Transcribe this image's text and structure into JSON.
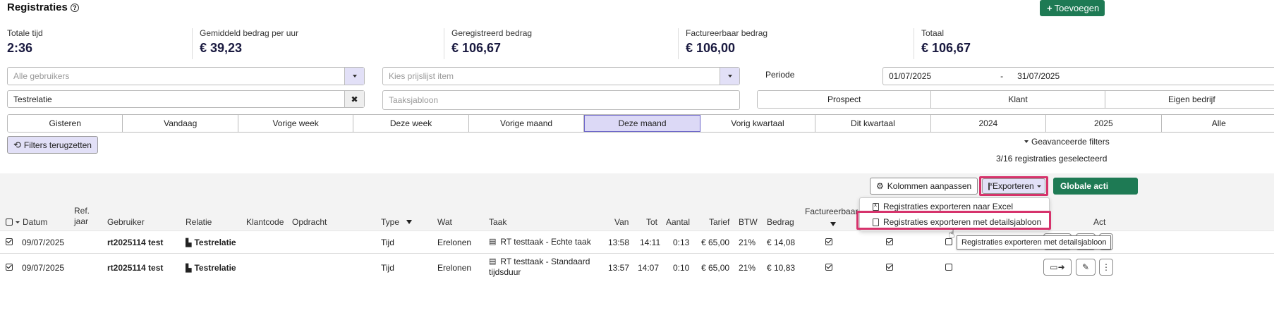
{
  "header": {
    "title": "Registraties",
    "add_label": "Toevoegen"
  },
  "stats": [
    {
      "label": "Totale tijd",
      "value": "2:36"
    },
    {
      "label": "Gemiddeld bedrag per uur",
      "value": "€ 39,23"
    },
    {
      "label": "Geregistreerd bedrag",
      "value": "€ 106,67"
    },
    {
      "label": "Factureerbaar bedrag",
      "value": "€ 106,00"
    },
    {
      "label": "Totaal",
      "value": "€ 106,67"
    }
  ],
  "filters": {
    "users_placeholder": "Alle gebruikers",
    "pricelist_placeholder": "Kies prijslijst item",
    "period_label": "Periode",
    "date_from": "01/07/2025",
    "date_sep": "-",
    "date_to": "31/07/2025",
    "relation_value": "Testrelatie",
    "task_template_placeholder": "Taaksjabloon",
    "relation_types": [
      "Prospect",
      "Klant",
      "Eigen bedrijf"
    ],
    "periods": [
      "Gisteren",
      "Vandaag",
      "Vorige week",
      "Deze week",
      "Vorige maand",
      "Deze maand",
      "Vorig kwartaal",
      "Dit kwartaal",
      "2024",
      "2025",
      "Alle"
    ],
    "active_period": "Deze maand",
    "reset_label": "Filters terugzetten",
    "advanced_label": "Geavanceerde filters",
    "selected_count": "3/16 registraties geselecteerd"
  },
  "toolbar": {
    "columns_label": "Kolommen aanpassen",
    "export_label": "Exporteren",
    "global_label": "Globale acti"
  },
  "export_menu": {
    "items": [
      "Registraties exporteren naar Excel",
      "Registraties exporteren met detailsjabloon"
    ],
    "tooltip": "Registraties exporteren met detailsjabloon"
  },
  "table": {
    "headers": {
      "datum": "Datum",
      "refjaar_1": "Ref.",
      "refjaar_2": "jaar",
      "gebruiker": "Gebruiker",
      "relatie": "Relatie",
      "klantcode": "Klantcode",
      "opdracht": "Opdracht",
      "type": "Type",
      "wat": "Wat",
      "taak": "Taak",
      "van": "Van",
      "tot": "Tot",
      "aantal": "Aantal",
      "tarief": "Tarief",
      "btw": "BTW",
      "bedrag": "Bedrag",
      "factureerbaar": "Factureerbaar",
      "acties": "Act"
    },
    "rows": [
      {
        "datum": "09/07/2025",
        "gebruiker": "rt2025114 test",
        "relatie": "Testrelatie",
        "type": "Tijd",
        "wat": "Erelonen",
        "taak_1": "RT testtaak - Echte taak",
        "taak_2": "",
        "van": "13:58",
        "tot": "14:11",
        "aantal": "0:13",
        "tarief": "€ 65,00",
        "btw": "21%",
        "bedrag": "€ 14,08"
      },
      {
        "datum": "09/07/2025",
        "gebruiker": "rt2025114 test",
        "relatie": "Testrelatie",
        "type": "Tijd",
        "wat": "Erelonen",
        "taak_1": "RT testtaak - Standaard",
        "taak_2": "tijdsduur",
        "van": "13:57",
        "tot": "14:07",
        "aantal": "0:10",
        "tarief": "€ 65,00",
        "btw": "21%",
        "bedrag": "€ 10,83"
      }
    ]
  }
}
